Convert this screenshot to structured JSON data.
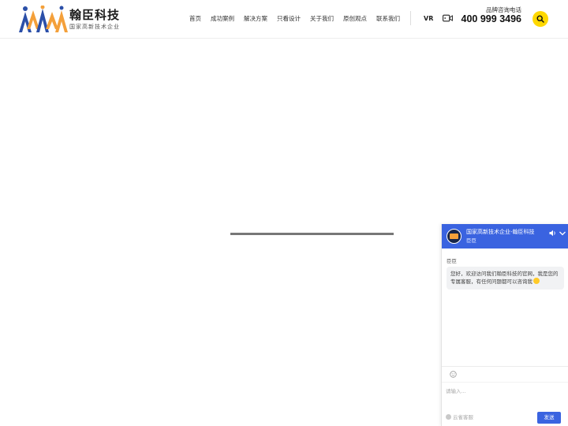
{
  "header": {
    "brand_name": "翰臣科技",
    "brand_slogan": "国家高新技术企业",
    "nav": [
      {
        "label": "首页"
      },
      {
        "label": "成功案例"
      },
      {
        "label": "解决方案"
      },
      {
        "label": "只看设计"
      },
      {
        "label": "关于我们"
      },
      {
        "label": "原创观点"
      },
      {
        "label": "联系我们"
      }
    ],
    "vr_label": "VR",
    "phone_label": "品牌咨询电话",
    "phone_number": "400 999 3496",
    "icons": {
      "video": "video-camera-icon",
      "search": "search-icon"
    },
    "colors": {
      "search_button": "#ffd800",
      "logo_blue": "#2b4fa8",
      "logo_orange": "#f4a03a"
    }
  },
  "loading": {
    "progress": 1.0,
    "color": "#777777"
  },
  "chat": {
    "title": "国家高新技术企业-翰臣科技",
    "subtitle": "臣臣",
    "agent_name": "臣臣",
    "greeting": "您好，欢迎访问我们翰臣科技的官网，我是您的专属客服，有任何问题都可以咨询我",
    "input_placeholder": "请输入...",
    "powered_by": "云雀客服",
    "send_label": "发送",
    "icons": {
      "sound": "speaker-icon",
      "collapse": "chevron-down-icon",
      "emoji": "smiley-icon"
    },
    "colors": {
      "header": "#3a63e0",
      "send_button": "#3a63e0"
    }
  }
}
